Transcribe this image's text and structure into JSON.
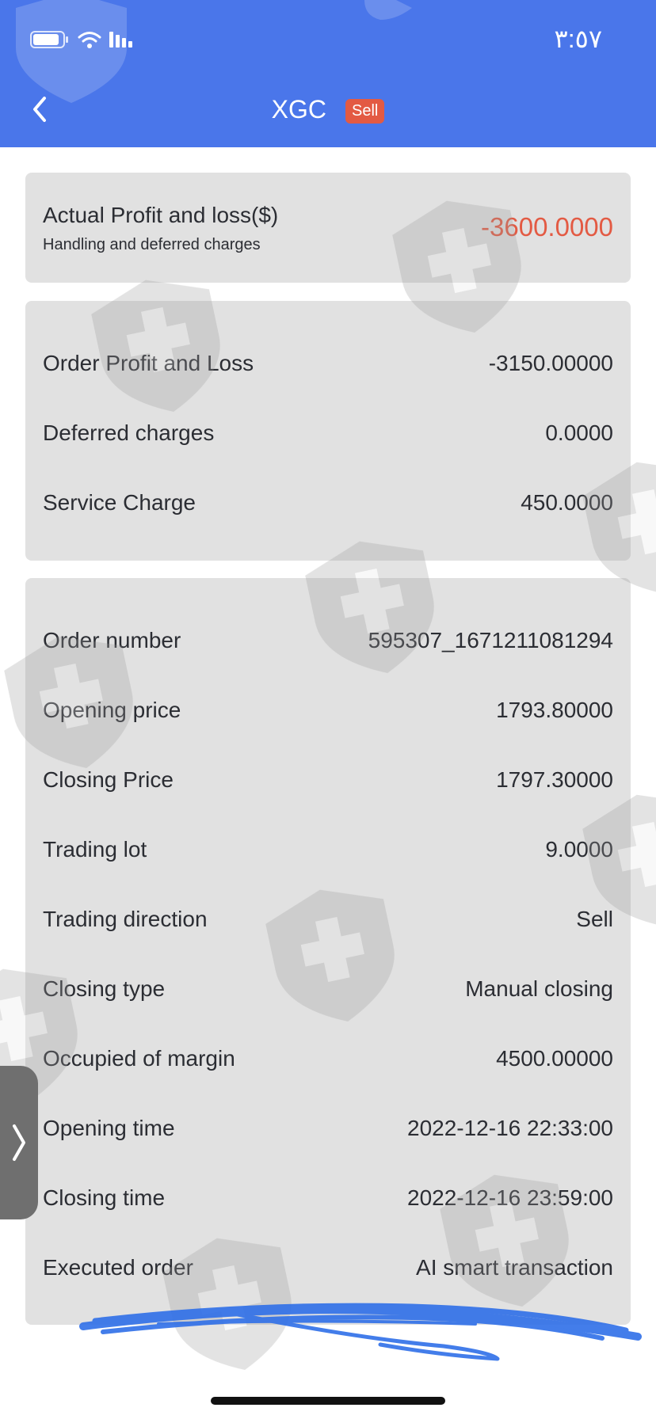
{
  "status_bar": {
    "time": "٣:٥٧",
    "icons": [
      "battery-icon",
      "wifi-icon",
      "signal-icon"
    ]
  },
  "nav": {
    "title": "XGC",
    "badge": "Sell",
    "back_icon": "chevron-left-icon"
  },
  "summary": {
    "title": "Actual Profit and loss($)",
    "subtitle": "Handling and deferred charges",
    "value": "-3600.0000",
    "value_color": "#e35a43"
  },
  "fees": [
    {
      "label": "Order Profit and Loss",
      "value": "-3150.00000"
    },
    {
      "label": "Deferred charges",
      "value": "0.0000"
    },
    {
      "label": "Service Charge",
      "value": "450.0000"
    }
  ],
  "order": [
    {
      "label": "Order number",
      "value": "595307_1671211081294"
    },
    {
      "label": "Opening price",
      "value": "1793.80000"
    },
    {
      "label": "Closing Price",
      "value": "1797.30000"
    },
    {
      "label": "Trading lot",
      "value": "9.0000"
    },
    {
      "label": "Trading direction",
      "value": "Sell"
    },
    {
      "label": "Closing type",
      "value": "Manual closing"
    },
    {
      "label": "Occupied of margin",
      "value": "4500.00000"
    },
    {
      "label": "Opening time",
      "value": "2022-12-16 22:33:00"
    },
    {
      "label": "Closing time",
      "value": "2022-12-16 23:59:00"
    },
    {
      "label": "Executed order",
      "value": "AI smart transaction"
    }
  ],
  "colors": {
    "header": "#4a76ea",
    "card": "#e1e1e1",
    "loss": "#e35a43",
    "badge": "#e35a43"
  },
  "side_handle_icon": "chevron-right-icon"
}
